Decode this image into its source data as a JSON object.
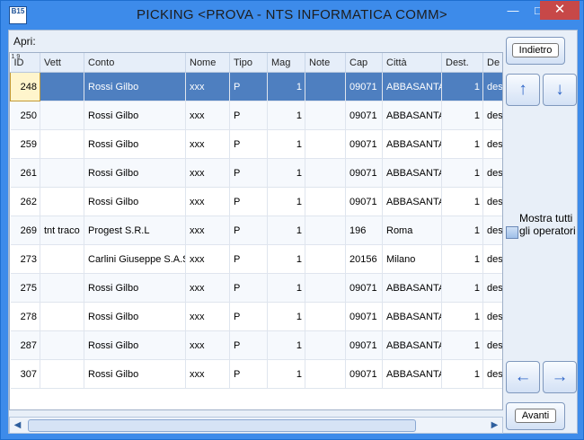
{
  "window": {
    "app_icon_label": "B15",
    "title": "PICKING <PROVA - NTS INFORMATICA COMM>",
    "controls": {
      "minimize": "—",
      "maximize": "□",
      "close": "✕"
    }
  },
  "toolbar": {
    "apri_label": "Apri:"
  },
  "grid": {
    "row_number_label": "1 9",
    "columns": [
      "ID",
      "Vett",
      "Conto",
      "Nome",
      "Tipo",
      "Mag",
      "Note",
      "Cap",
      "Città",
      "Dest.",
      "De"
    ],
    "rows": [
      [
        "248",
        "",
        "Rossi Gilbo",
        "xxx",
        "P",
        "1",
        "",
        "09071",
        "ABBASANTA",
        "1",
        "des"
      ],
      [
        "250",
        "",
        "Rossi Gilbo",
        "xxx",
        "P",
        "1",
        "",
        "09071",
        "ABBASANTA",
        "1",
        "des"
      ],
      [
        "259",
        "",
        "Rossi Gilbo",
        "xxx",
        "P",
        "1",
        "",
        "09071",
        "ABBASANTA",
        "1",
        "des"
      ],
      [
        "261",
        "",
        "Rossi Gilbo",
        "xxx",
        "P",
        "1",
        "",
        "09071",
        "ABBASANTA",
        "1",
        "des"
      ],
      [
        "262",
        "",
        "Rossi Gilbo",
        "xxx",
        "P",
        "1",
        "",
        "09071",
        "ABBASANTA",
        "1",
        "des"
      ],
      [
        "269",
        "tnt traco",
        "Progest S.R.L",
        "xxx",
        "P",
        "1",
        "",
        "196",
        "Roma",
        "1",
        "des"
      ],
      [
        "273",
        "",
        "Carlini Giuseppe S.A.S",
        "xxx",
        "P",
        "1",
        "",
        "20156",
        "Milano",
        "1",
        "des"
      ],
      [
        "275",
        "",
        "Rossi Gilbo",
        "xxx",
        "P",
        "1",
        "",
        "09071",
        "ABBASANTA",
        "1",
        "des"
      ],
      [
        "278",
        "",
        "Rossi Gilbo",
        "xxx",
        "P",
        "1",
        "",
        "09071",
        "ABBASANTA",
        "1",
        "des"
      ],
      [
        "287",
        "",
        "Rossi Gilbo",
        "xxx",
        "P",
        "1",
        "",
        "09071",
        "ABBASANTA",
        "1",
        "des"
      ],
      [
        "307",
        "",
        "Rossi Gilbo",
        "xxx",
        "P",
        "1",
        "",
        "09071",
        "ABBASANTA",
        "1",
        "des"
      ]
    ]
  },
  "side": {
    "indietro_label": "Indietro",
    "avanti_label": "Avanti",
    "up_icon": "↑",
    "down_icon": "↓",
    "left_icon": "←",
    "right_icon": "→",
    "mostra_label": "Mostra tutti gli operatori"
  },
  "scroll": {
    "left_icon": "◀",
    "right_icon": "▶"
  },
  "colors": {
    "accent": "#3d8bea",
    "selected_row": "#4e7fc0",
    "close_button": "#c74848"
  }
}
